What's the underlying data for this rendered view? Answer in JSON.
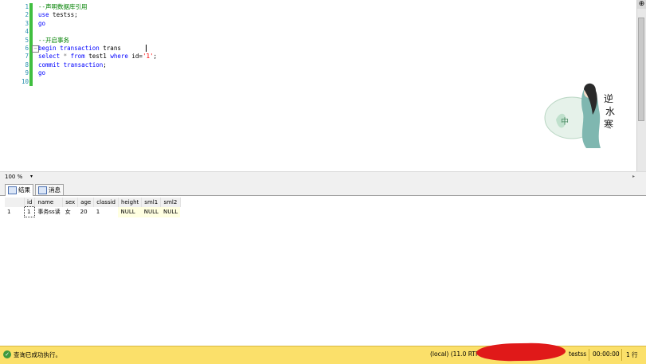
{
  "editor": {
    "line_numbers": [
      "1",
      "2",
      "3",
      "4",
      "5",
      "6",
      "7",
      "8",
      "9",
      "10"
    ],
    "lines": [
      [
        {
          "t": "--声明数据库引用",
          "c": "cm"
        }
      ],
      [
        {
          "t": "use",
          "c": "kw"
        },
        {
          "t": " testss;",
          "c": "plain"
        }
      ],
      [
        {
          "t": "go",
          "c": "kw"
        }
      ],
      [],
      [
        {
          "t": "--开启事务",
          "c": "cm"
        }
      ],
      [
        {
          "t": "begin transaction",
          "c": "kw"
        },
        {
          "t": " trans",
          "c": "plain"
        }
      ],
      [
        {
          "t": "select",
          "c": "kw"
        },
        {
          "t": " * ",
          "c": "gray"
        },
        {
          "t": "from",
          "c": "kw"
        },
        {
          "t": " test1 ",
          "c": "plain"
        },
        {
          "t": "where",
          "c": "kw"
        },
        {
          "t": " id=",
          "c": "plain"
        },
        {
          "t": "'1'",
          "c": "str"
        },
        {
          "t": ";",
          "c": "plain"
        }
      ],
      [
        {
          "t": "commit transaction",
          "c": "kw"
        },
        {
          "t": ";",
          "c": "plain"
        }
      ],
      [
        {
          "t": "go",
          "c": "kw"
        }
      ],
      []
    ],
    "fold_icon": "minus-box-icon"
  },
  "zoom": {
    "value": "100 %",
    "dropdown": "▾"
  },
  "tabs": [
    {
      "label": "结果",
      "icon": "grid-icon"
    },
    {
      "label": "消息",
      "icon": "message-icon"
    }
  ],
  "results": {
    "columns": [
      "id",
      "name",
      "sex",
      "age",
      "classid",
      "height",
      "sml1",
      "sml2"
    ],
    "rows": [
      {
        "rownum": "1",
        "cells": [
          "1",
          "事务ss读",
          "女",
          "20",
          "1",
          "NULL",
          "NULL",
          "NULL"
        ]
      }
    ]
  },
  "status": {
    "message": "查询已成功执行。",
    "server": "(local) (11.0 RTM)",
    "database": "testss",
    "elapsed": "00:00:00",
    "rows": "1 行"
  },
  "colors": {
    "status_bar": "#fbe06a",
    "keyword": "#0000ff",
    "comment": "#008000",
    "string": "#ff0000",
    "redaction": "#e01919"
  }
}
